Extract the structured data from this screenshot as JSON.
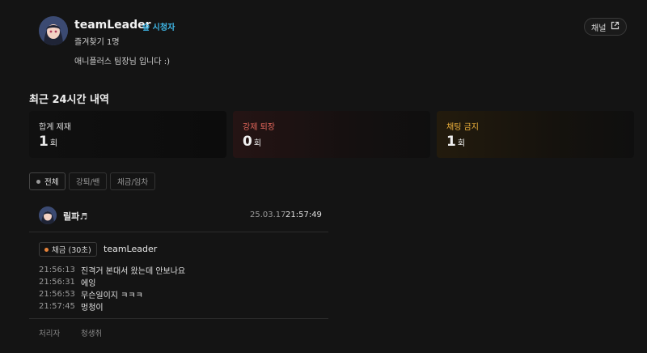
{
  "channel": {
    "name": "teamLeader",
    "badge": "숲 시청자",
    "favorites": "즐겨찾기 1명",
    "description": "애니플러스 팀장님 입니다 :)",
    "channel_button": "채널"
  },
  "summary": {
    "title": "최근 24시간 내역",
    "cards": [
      {
        "label": "합계 제재",
        "value": "1",
        "unit": "회",
        "color": "#e8e8e8"
      },
      {
        "label": "강제 퇴장",
        "value": "0",
        "unit": "회",
        "color": "#e5675c"
      },
      {
        "label": "채팅 금지",
        "value": "1",
        "unit": "회",
        "color": "#f0b33c"
      }
    ]
  },
  "filters": [
    "전체",
    "강퇴/밴",
    "채금/임차"
  ],
  "record": {
    "moderator": "릴파♬",
    "date": "25.03.17",
    "time": "21:57:49",
    "action": "채금 (30초)",
    "target": "teamLeader",
    "logs": [
      {
        "time": "21:56:13",
        "msg": "진격거 본대서 왔는데 안보나요"
      },
      {
        "time": "21:56:31",
        "msg": "에잉"
      },
      {
        "time": "21:56:53",
        "msg": "무슨일이지 ㅋㅋㅋ"
      },
      {
        "time": "21:57:45",
        "msg": "멍청이"
      }
    ],
    "footer_label": "처리자",
    "footer_value": "청생취"
  },
  "colors": {
    "background": "#141414",
    "accent_teal": "#3fb8e8",
    "orange_dot": "#e8833a"
  },
  "icons": {
    "external": "external-link-icon",
    "dot": "dot-icon"
  }
}
